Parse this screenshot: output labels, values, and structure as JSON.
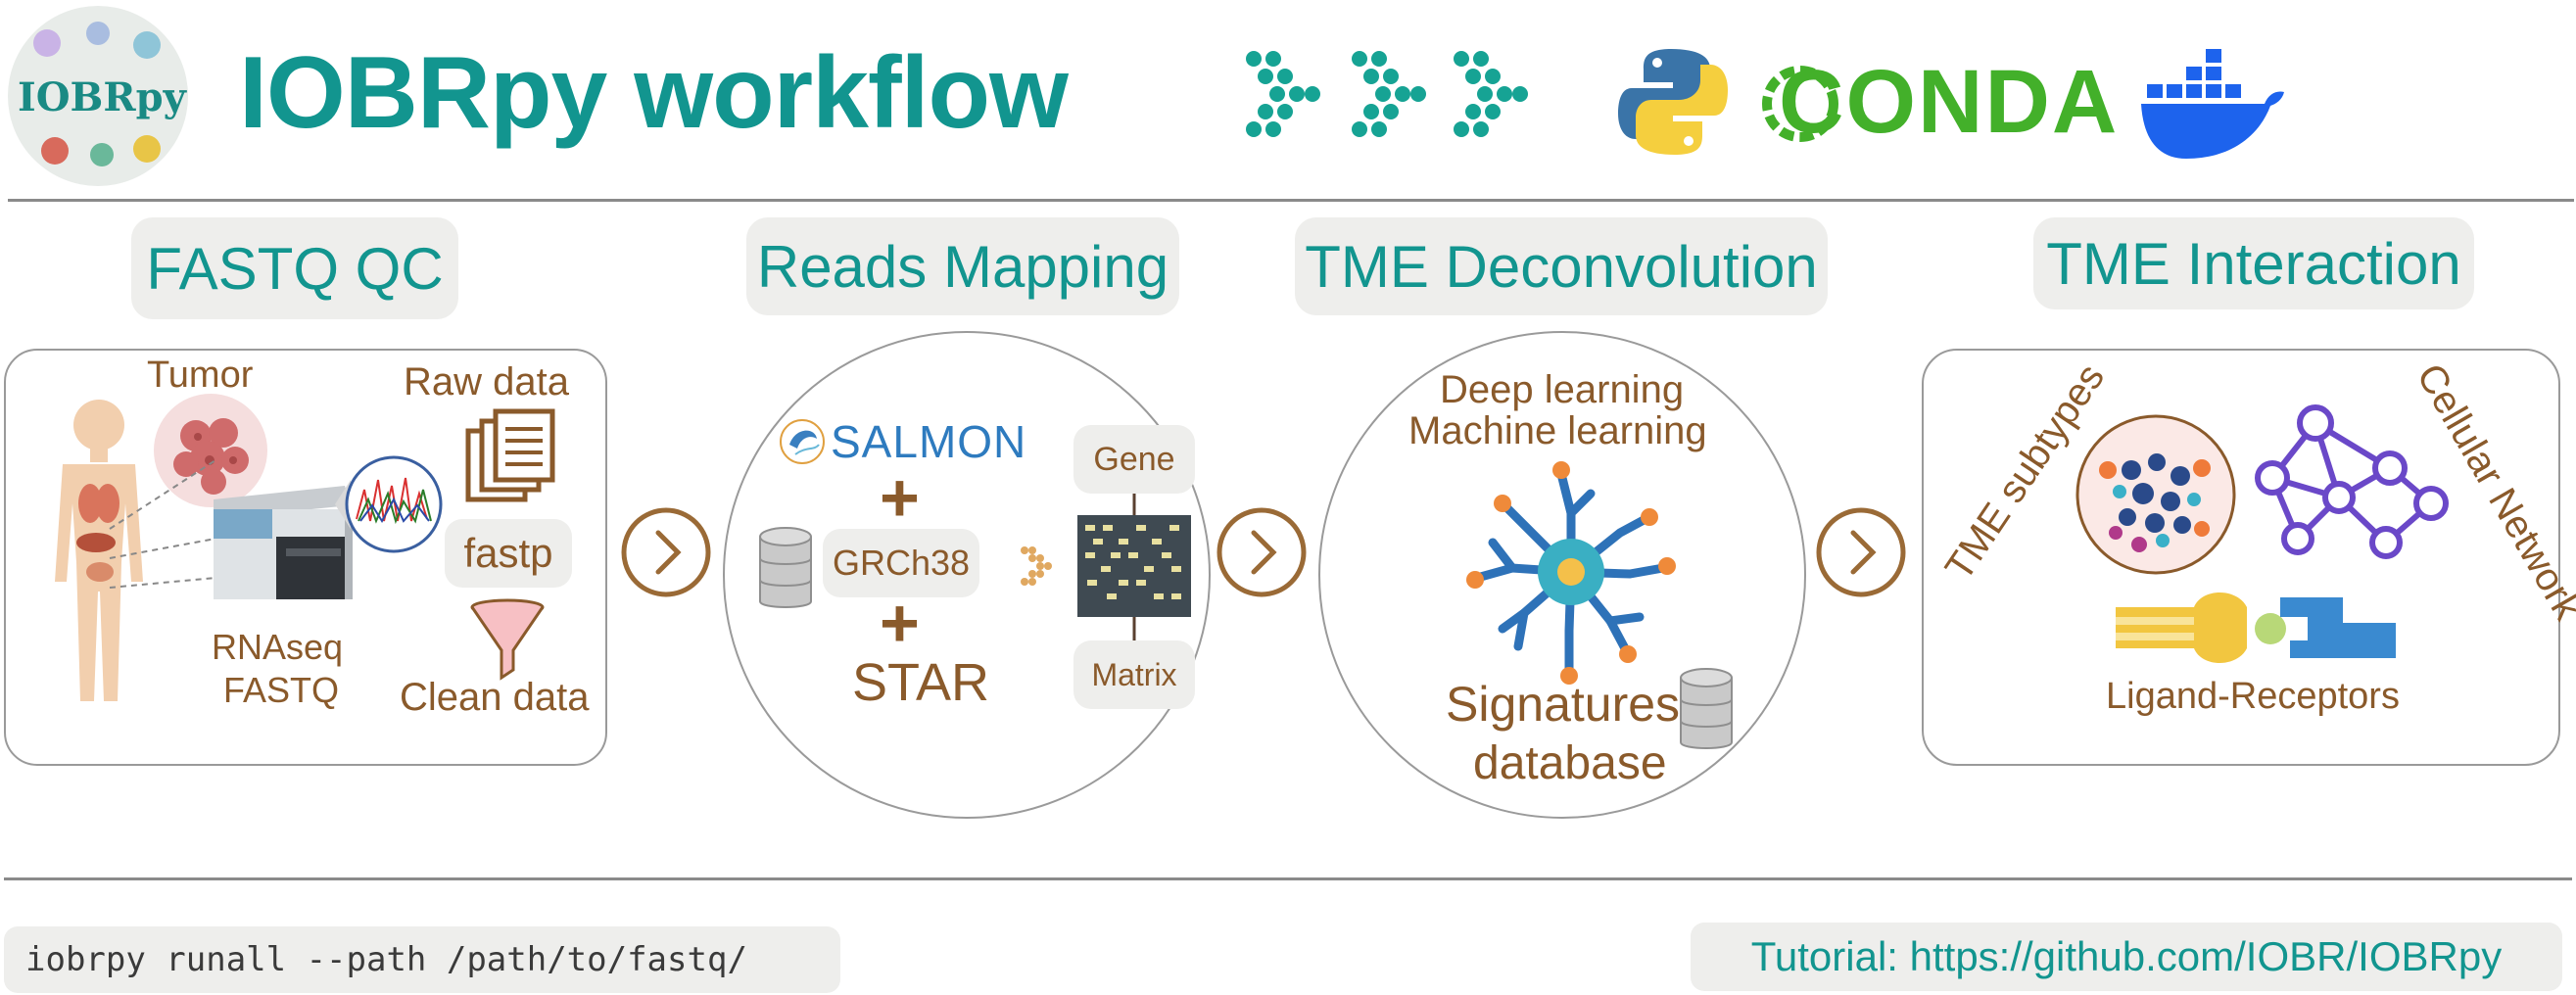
{
  "header": {
    "logo_text": "IOBRpy",
    "title": "IOBRpy workflow",
    "tools": [
      "python-logo",
      "conda-logo",
      "docker-logo"
    ],
    "conda_text": "CONDA"
  },
  "steps": [
    {
      "label": "FASTQ QC"
    },
    {
      "label": "Reads Mapping"
    },
    {
      "label": "TME Deconvolution"
    },
    {
      "label": "TME Interaction"
    }
  ],
  "qc_panel": {
    "tumor": "Tumor",
    "raw_data": "Raw data",
    "fastp": "fastp",
    "rnaseq_line1": "RNAseq",
    "rnaseq_line2": "FASTQ",
    "clean_data": "Clean data"
  },
  "mapping_panel": {
    "salmon": "SALMON",
    "plus": "+",
    "grch38": "GRCh38",
    "star": "STAR",
    "gene": "Gene",
    "matrix": "Matrix"
  },
  "deconv_panel": {
    "line1": "Deep learning",
    "line2": "Machine learning",
    "sig_line1": "Signatures",
    "sig_line2": "database"
  },
  "interaction_panel": {
    "subtypes": "TME subtypes",
    "network": "Cellular Network",
    "ligand": "Ligand-Receptors"
  },
  "footer": {
    "command": "iobrpy runall --path /path/to/fastq/",
    "tutorial": "Tutorial: https://github.com/IOBR/IOBRpy"
  },
  "colors": {
    "teal": "#12958f",
    "brown": "#8a5a2b",
    "pill_bg": "#eeeeec",
    "conda_green": "#43b02a",
    "docker_blue": "#1d63ed"
  }
}
